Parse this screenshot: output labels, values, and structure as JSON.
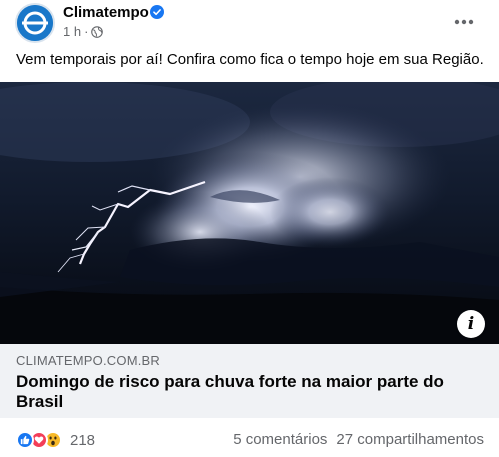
{
  "post": {
    "page_name": "Climatempo",
    "timestamp": "1 h",
    "separator": "·",
    "text": "Vem temporais por aí! Confira como fica o tempo hoje em sua Região."
  },
  "link": {
    "domain": "CLIMATEMPO.COM.BR",
    "title": "Domingo de risco para chuva forte na maior parte do Brasil"
  },
  "engagement": {
    "reaction_count": "218",
    "comments": "5 comentários",
    "shares": "27 compartilhamentos"
  },
  "icons": {
    "verified": "verified-badge-icon",
    "audience": "globe-icon",
    "more": "more-options-icon",
    "info": "info-icon",
    "reactions": [
      "like-icon",
      "love-icon",
      "wow-icon"
    ]
  },
  "colors": {
    "brand_blue": "#1877f2",
    "secondary_text": "#65676b",
    "link_box_bg": "#f0f2f5"
  }
}
